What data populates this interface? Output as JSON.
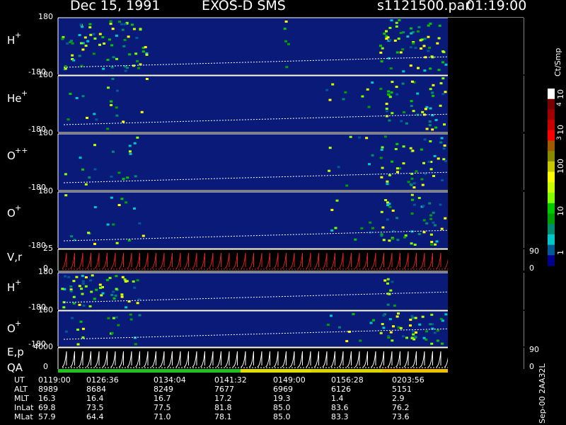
{
  "header": {
    "date": "Dec 15, 1991",
    "instrument": "EXOS-D SMS",
    "file": "s1121500.par",
    "time": "01:19:00"
  },
  "panels": [
    {
      "label": "H",
      "sup": "+",
      "top": "180",
      "bottom": "-180"
    },
    {
      "label": "He",
      "sup": "+",
      "top": "180",
      "bottom": "-180"
    },
    {
      "label": "O",
      "sup": "++",
      "top": "180",
      "bottom": "-180"
    },
    {
      "label": "O",
      "sup": "+",
      "top": "180",
      "bottom": "-180"
    },
    {
      "label": "V,r",
      "sup": "",
      "top": "25",
      "bottom": "0",
      "right_top": "90",
      "right_bottom": "0"
    },
    {
      "label": "H",
      "sup": "+",
      "top": "180",
      "bottom": "-180"
    },
    {
      "label": "O",
      "sup": "+",
      "top": "180",
      "bottom": "-180"
    },
    {
      "label": "E,p",
      "label2": "QA",
      "sup": "",
      "top": "4000",
      "bottom": "0",
      "right_top": "90",
      "right_bottom": "0"
    }
  ],
  "colorbar": {
    "title": "Ct/Smp",
    "ticks": [
      "10",
      "4",
      "10",
      "3",
      "100",
      "10",
      "1"
    ],
    "colors": [
      "#ffffff",
      "#7a0000",
      "#a00000",
      "#c80000",
      "#ff0000",
      "#a05a00",
      "#8a8a00",
      "#c8c800",
      "#ffff00",
      "#c8ff00",
      "#80ff00",
      "#00c800",
      "#00a000",
      "#008c6e",
      "#00c8c8",
      "#005a96",
      "#00008c"
    ]
  },
  "chart_data": {
    "type": "heatmap",
    "title": "Dec 15, 1991   EXOS-D SMS",
    "x_ticks": [
      "0119:00",
      "0126:36",
      "0134:04",
      "0141:32",
      "0149:00",
      "0156:28",
      "0203:56"
    ],
    "ephemeris": {
      "rows": [
        {
          "name": "UT",
          "values": [
            "0119:00",
            "0126:36",
            "0134:04",
            "0141:32",
            "0149:00",
            "0156:28",
            "0203:56"
          ]
        },
        {
          "name": "ALT",
          "values": [
            "8989",
            "8684",
            "8249",
            "7677",
            "6969",
            "6126",
            "5151"
          ]
        },
        {
          "name": "MLT",
          "values": [
            "16.3",
            "16.4",
            "16.7",
            "17.2",
            "19.3",
            "1.4",
            "2.9"
          ]
        },
        {
          "name": "InLat",
          "values": [
            "69.8",
            "73.5",
            "77.5",
            "81.8",
            "85.0",
            "83.6",
            "76.2"
          ]
        },
        {
          "name": "MLat",
          "values": [
            "57.9",
            "64.4",
            "71.0",
            "78.1",
            "85.0",
            "83.3",
            "73.6"
          ]
        }
      ]
    }
  },
  "footer": {
    "stamp": "Sep-00 2AA32L"
  }
}
